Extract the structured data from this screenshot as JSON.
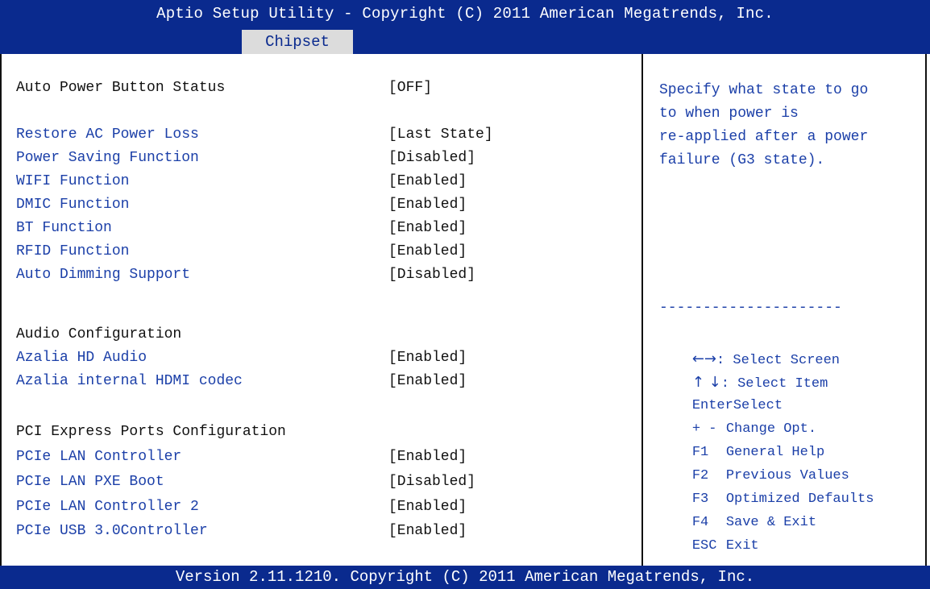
{
  "header": {
    "title": "Aptio Setup Utility - Copyright (C) 2011 American Megatrends, Inc.",
    "active_tab": "Chipset"
  },
  "settings": [
    {
      "label": "Auto Power Button Status",
      "value": "[OFF]",
      "selectable": false
    },
    {
      "label": "Restore AC Power Loss",
      "value": "[Last State]",
      "selectable": true
    },
    {
      "label": "Power Saving Function",
      "value": "[Disabled]",
      "selectable": true
    },
    {
      "label": "WIFI Function",
      "value": "[Enabled]",
      "selectable": true
    },
    {
      "label": "DMIC Function",
      "value": "[Enabled]",
      "selectable": true
    },
    {
      "label": "BT Function",
      "value": "[Enabled]",
      "selectable": true
    },
    {
      "label": "RFID Function",
      "value": "[Enabled]",
      "selectable": true
    },
    {
      "label": "Auto Dimming Support",
      "value": "[Disabled]",
      "selectable": true
    },
    {
      "label": "Azalia HD Audio",
      "value": "[Enabled]",
      "selectable": true
    },
    {
      "label": "Azalia internal HDMI codec",
      "value": "[Enabled]",
      "selectable": true
    },
    {
      "label": "PCIe LAN Controller",
      "value": "[Enabled]",
      "selectable": true
    },
    {
      "label": "PCIe LAN PXE Boot",
      "value": "[Disabled]",
      "selectable": true
    },
    {
      "label": "PCIe LAN Controller 2",
      "value": "[Enabled]",
      "selectable": true
    },
    {
      "label": "PCIe USB 3.0Controller",
      "value": "[Enabled]",
      "selectable": true
    }
  ],
  "headings": {
    "audio": "Audio Configuration",
    "pci": "PCI Express Ports Configuration"
  },
  "help": {
    "lines": [
      "Specify what state to go",
      "to when power is",
      "re-applied after a power",
      "failure (G3 state)."
    ],
    "separator": "---------------------"
  },
  "keys": [
    {
      "key": "←→",
      "desc": ": Select Screen"
    },
    {
      "key": "↑ ↓",
      "desc": ": Select Item"
    },
    {
      "key": "Enter",
      "desc": "Select"
    },
    {
      "key": "+ -",
      "desc": "Change Opt."
    },
    {
      "key": "F1",
      "desc": "General Help"
    },
    {
      "key": "F2",
      "desc": "Previous Values"
    },
    {
      "key": "F3",
      "desc": "Optimized Defaults"
    },
    {
      "key": "F4",
      "desc": "Save & Exit"
    },
    {
      "key": "ESC",
      "desc": "Exit"
    }
  ],
  "footer": "Version 2.11.1210. Copyright (C) 2011 American Megatrends, Inc.",
  "colors": {
    "bar": "#0a2a8e",
    "selectable_text": "#1b3fa8",
    "tab_bg": "#dcdcdc"
  }
}
